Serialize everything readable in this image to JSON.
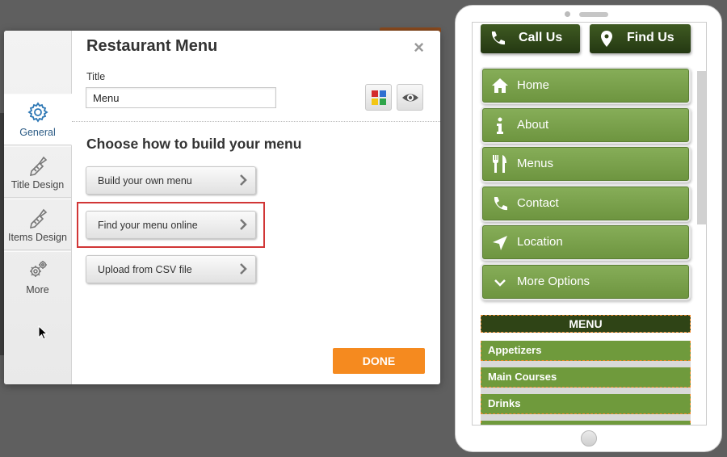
{
  "dialog": {
    "title": "Restaurant Menu",
    "close_label": "×",
    "title_field_label": "Title",
    "title_field_value": "Menu",
    "section_title": "Choose how to build your menu",
    "options": [
      {
        "label": "Build your own menu"
      },
      {
        "label": "Find your menu online"
      },
      {
        "label": "Upload from CSV file"
      }
    ],
    "done_label": "DONE"
  },
  "sidenav": {
    "items": [
      {
        "label": "General",
        "icon": "gear-icon",
        "active": true
      },
      {
        "label": "Title Design",
        "icon": "paintbrush-icon"
      },
      {
        "label": "Items Design",
        "icon": "paintbrush-icon"
      },
      {
        "label": "More",
        "icon": "gears-icon"
      }
    ]
  },
  "phone": {
    "top_buttons": [
      {
        "label": "Call Us",
        "icon": "phone-icon"
      },
      {
        "label": "Find Us",
        "icon": "map-pin-icon"
      }
    ],
    "nav": [
      {
        "label": "Home",
        "icon": "home-icon"
      },
      {
        "label": "About",
        "icon": "info-icon"
      },
      {
        "label": "Menus",
        "icon": "fork-knife-icon"
      },
      {
        "label": "Contact",
        "icon": "phone-icon"
      },
      {
        "label": "Location",
        "icon": "location-arrow-icon"
      },
      {
        "label": "More Options",
        "icon": "chevron-down-icon"
      }
    ],
    "menu_header": "MENU",
    "menu_items": [
      "Appetizers",
      "Main Courses",
      "Drinks"
    ]
  },
  "colors": {
    "accent_orange": "#f58a1f",
    "phone_green": "#7aa24b",
    "phone_dark_green": "#2f4416",
    "highlight_red": "#d13636"
  }
}
